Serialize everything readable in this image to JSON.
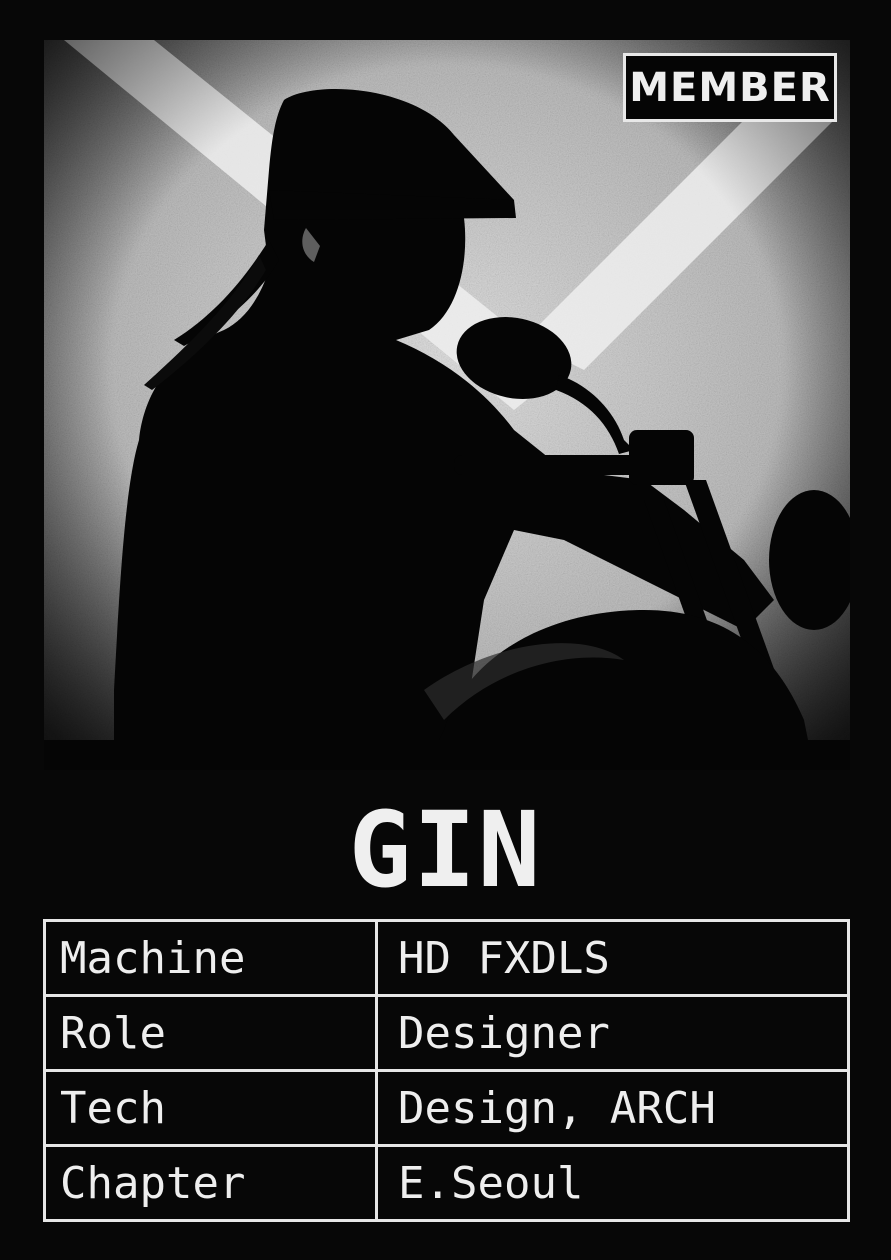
{
  "badge": {
    "label": "MEMBER"
  },
  "member": {
    "name": "GIN"
  },
  "photo": {
    "subject": "rider-on-motorcycle-silhouette",
    "style": "grainy black and white",
    "background_color": "#d9d9d9",
    "silhouette_color": "#050505"
  },
  "specs": {
    "rows": [
      {
        "key": "Machine",
        "value": "HD FXDLS"
      },
      {
        "key": "Role",
        "value": "Designer"
      },
      {
        "key": "Tech",
        "value": "Design, ARCH"
      },
      {
        "key": "Chapter",
        "value": "E.Seoul"
      }
    ]
  }
}
